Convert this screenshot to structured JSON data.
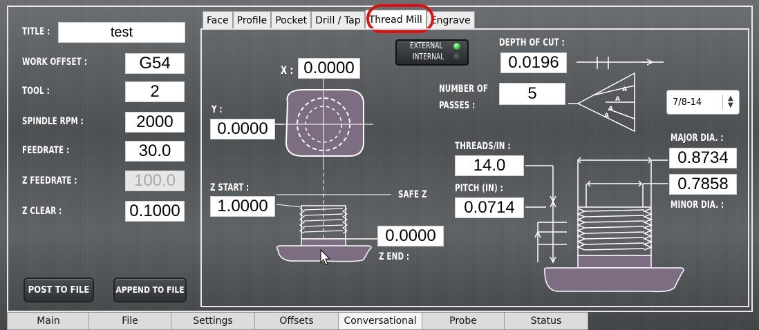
{
  "left": {
    "title_label": "TITLE :",
    "title_value": "test",
    "work_offset_label": "WORK OFFSET :",
    "work_offset_value": "G54",
    "tool_label": "TOOL :",
    "tool_value": "2",
    "spindle_label": "SPINDLE RPM :",
    "spindle_value": "2000",
    "feedrate_label": "FEEDRATE :",
    "feedrate_value": "30.0",
    "zfeed_label": "Z FEEDRATE :",
    "zfeed_value": "100.0",
    "zclear_label": "Z CLEAR :",
    "zclear_value": "0.1000",
    "post_button": "POST TO FILE",
    "append_button": "APPEND TO FILE"
  },
  "top_tabs": [
    {
      "label": "Face"
    },
    {
      "label": "Profile"
    },
    {
      "label": "Pocket"
    },
    {
      "label": "Drill / Tap"
    },
    {
      "label": "Thread Mill"
    },
    {
      "label": "Engrave"
    }
  ],
  "panel": {
    "external_label": "EXTERNAL",
    "internal_label": "INTERNAL",
    "x_label": "X :",
    "x_value": "0.0000",
    "y_label": "Y :",
    "y_value": "0.0000",
    "depth_label": "DEPTH OF CUT :",
    "depth_value": "0.0196",
    "passes_label_1": "NUMBER OF",
    "passes_label_2": "PASSES :",
    "passes_value": "5",
    "thread_select": "7/8-14",
    "threads_label": "THREADS/IN :",
    "threads_value": "14.0",
    "pitch_label": "PITCH (IN) :",
    "pitch_value": "0.0714",
    "zstart_label": "Z START :",
    "zstart_value": "1.0000",
    "safez_label": "SAFE Z",
    "zend_value": "0.0000",
    "zend_label": "Z END :",
    "major_label": "MAJOR DIA. :",
    "major_value": "0.8734",
    "minor_value": "0.7858",
    "minor_label": "MINOR DIA. :"
  },
  "bottom_tabs": [
    {
      "label": "Main"
    },
    {
      "label": "File"
    },
    {
      "label": "Settings"
    },
    {
      "label": "Offsets"
    },
    {
      "label": "Conversational"
    },
    {
      "label": "Probe"
    },
    {
      "label": "Status"
    }
  ],
  "colors": {
    "led_external": "#3ecf3e",
    "highlight": "#e01010",
    "part_fill": "#7d6d82"
  }
}
